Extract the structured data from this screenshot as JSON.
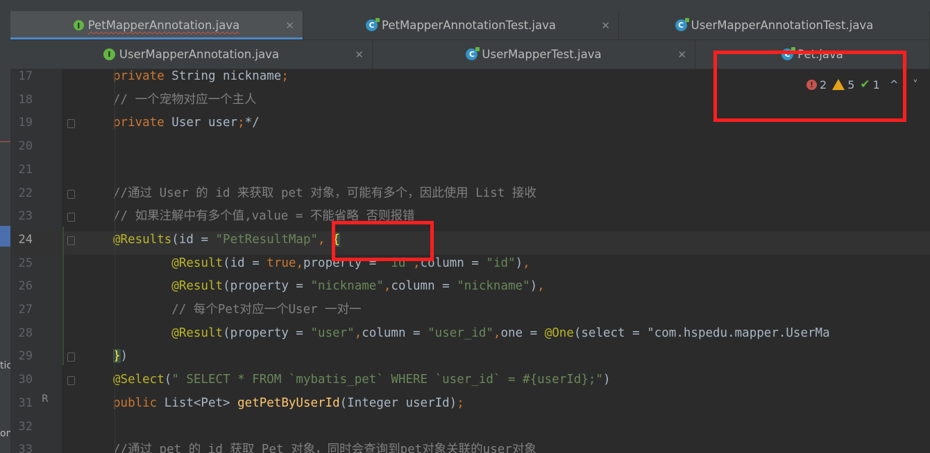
{
  "tabs": {
    "row1": [
      {
        "label": "PetMapperAnnotation.java",
        "kind": "interface",
        "active": true
      },
      {
        "label": "PetMapperAnnotationTest.java",
        "kind": "class",
        "active": false
      },
      {
        "label": "UserMapperAnnotationTest.java",
        "kind": "class",
        "active": false
      }
    ],
    "row2": [
      {
        "label": "UserMapperAnnotation.java",
        "kind": "interface",
        "active": false
      },
      {
        "label": "UserMapperTest.java",
        "kind": "class",
        "active": false
      },
      {
        "label": "Pet.java",
        "kind": "class",
        "active": false
      }
    ],
    "close_glyph": "✕",
    "interface_glyph": "I",
    "class_glyph": "C"
  },
  "left_strip": {
    "frag1": "tic",
    "frag2": "on"
  },
  "editor": {
    "current_line": 24,
    "lines": [
      {
        "n": 17,
        "text": "    private String nickname;"
      },
      {
        "n": 18,
        "text": "    // 一个宠物对应一个主人"
      },
      {
        "n": 19,
        "text": "    private User user;*/"
      },
      {
        "n": 20,
        "text": ""
      },
      {
        "n": 21,
        "text": ""
      },
      {
        "n": 22,
        "text": "    //通过 User 的 id 来获取 pet 对象，可能有多个，因此使用 List 接收"
      },
      {
        "n": 23,
        "text": "    // 如果注解中有多个值,value = 不能省略 否则报错"
      },
      {
        "n": 24,
        "text": "    @Results(id = \"PetResultMap\", {"
      },
      {
        "n": 25,
        "text": "            @Result(id = true,property = \"id\",column = \"id\"),"
      },
      {
        "n": 26,
        "text": "            @Result(property = \"nickname\",column = \"nickname\"),"
      },
      {
        "n": 27,
        "text": "            // 每个Pet对应一个User 一对一"
      },
      {
        "n": 28,
        "text": "            @Result(property = \"user\",column = \"user_id\",one = @One(select = \"com.hspedu.mapper.UserMa"
      },
      {
        "n": 29,
        "text": "    })"
      },
      {
        "n": 30,
        "text": "    @Select(\" SELECT * FROM `mybatis_pet` WHERE `user_id` = #{userId};\")"
      },
      {
        "n": 31,
        "text": "    public List<Pet> getPetByUserId(Integer userId);"
      },
      {
        "n": 32,
        "text": ""
      },
      {
        "n": 33,
        "text": "    //通过 pet 的 id 获取 Pet 对象，同时会查询到pet对象关联的user对象"
      }
    ]
  },
  "inspection": {
    "errors": "2",
    "warnings": "5",
    "typos": "1",
    "error_glyph": "!",
    "check_glyph": "✔",
    "nav_glyphs": "^ ˅"
  },
  "author_glyph": "R",
  "colors": {
    "keyword": "#cc7832",
    "string": "#6a8759",
    "comment": "#808080",
    "annotation": "#bbb529",
    "method": "#ffc66d",
    "text": "#a9b7c6",
    "highlight_box": "#ff1f1f"
  }
}
